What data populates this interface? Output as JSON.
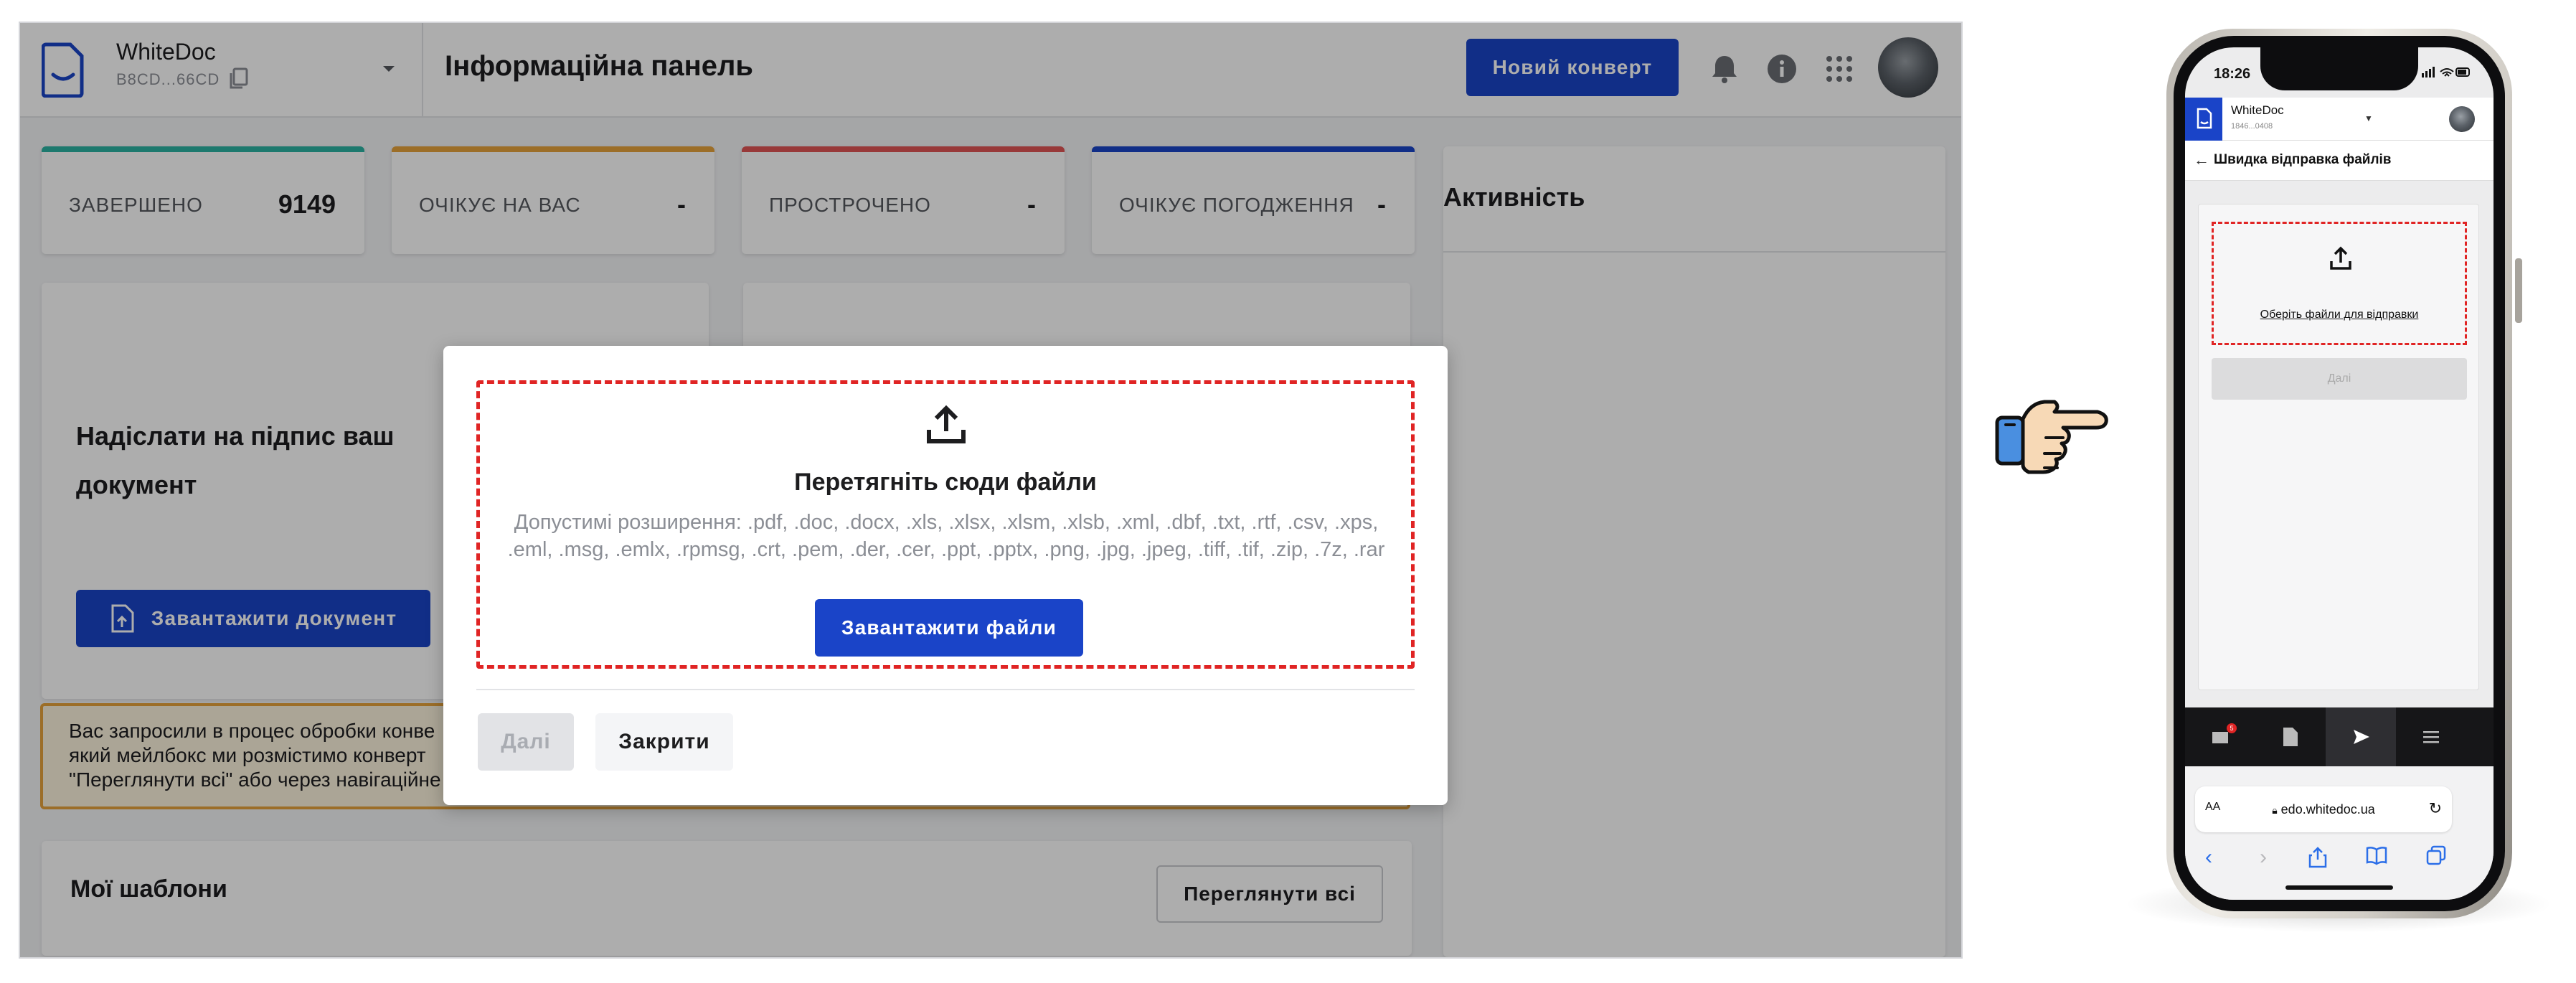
{
  "colors": {
    "primary": "#1a44c8",
    "danger_dashed": "#e02424",
    "completed_accent": "#2bb3a3",
    "waiting_accent": "#e6a23c",
    "overdue_accent": "#e05555",
    "approval_accent": "#1a44c8"
  },
  "header": {
    "app_name": "WhiteDoc",
    "account_id": "B8CD...66CD",
    "page_title": "Інформаційна панель",
    "new_envelope_label": "Новий конверт",
    "icons": [
      "bell-icon",
      "info-icon",
      "apps-grid-icon"
    ]
  },
  "stats": [
    {
      "label": "ЗАВЕРШЕНО",
      "value": "9149"
    },
    {
      "label": "ОЧІКУЄ НА ВАС",
      "value": "-"
    },
    {
      "label": "ПРОСТРОЧЕНО",
      "value": "-"
    },
    {
      "label": "ОЧІКУЄ ПОГОДЖЕННЯ",
      "value": "-"
    }
  ],
  "send_card": {
    "title": "Надіслати на підпис ваш документ",
    "upload_label": "Завантажити документ"
  },
  "notice": {
    "line1": "Вас запросили в процес обробки конве",
    "line2": "який мейлбокс ми розмістимо конверт",
    "line3": "\"Переглянути всі\" або через навігаційне"
  },
  "templates": {
    "title": "Мої шаблони",
    "view_all_label": "Переглянути всі"
  },
  "activity": {
    "title": "Активність"
  },
  "modal": {
    "drop_title": "Перетягніть сюди файли",
    "extensions": "Допустимі розширення: .pdf, .doc, .docx, .xls, .xlsx, .xlsm, .xlsb, .xml, .dbf, .txt, .rtf, .csv, .xps, .eml, .msg, .emlx, .rpmsg, .crt, .pem, .der, .cer, .ppt, .pptx, .png, .jpg, .jpeg, .tiff, .tif, .zip, .7z, .rar",
    "upload_files_label": "Завантажити файли",
    "next_label": "Далі",
    "close_label": "Закрити"
  },
  "phone": {
    "time": "18:26",
    "app_name": "WhiteDoc",
    "account_id": "1846...0408",
    "page_title": "Швидка відправка файлів",
    "choose_files": "Оберіть файли для відправки",
    "next_label": "Далі",
    "badge": "5",
    "url_aa": "AA",
    "domain": "edo.whitedoc.ua"
  }
}
